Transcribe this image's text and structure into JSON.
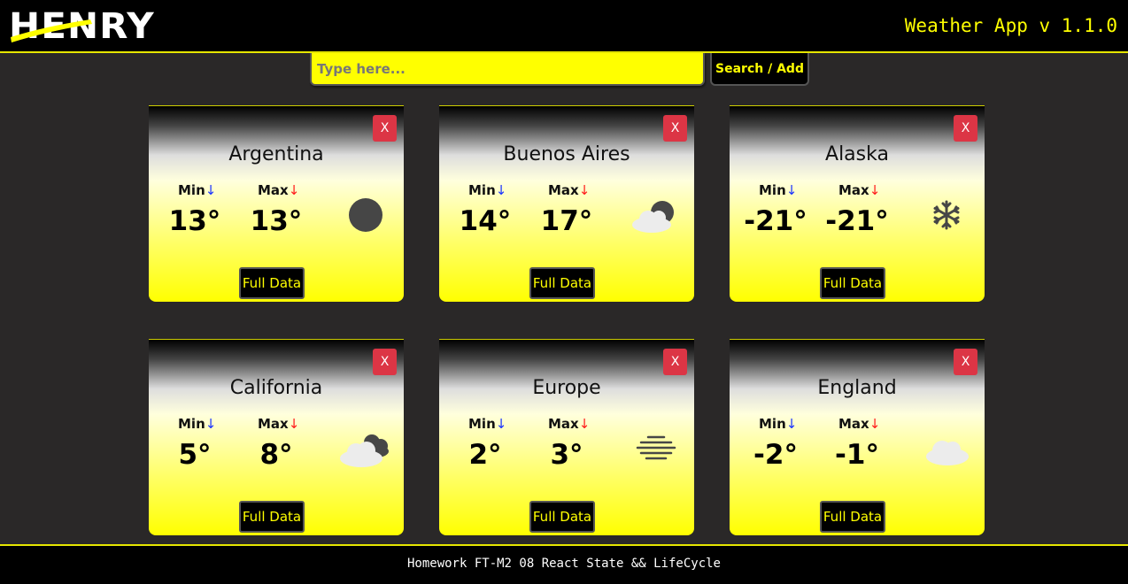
{
  "header": {
    "logo_text": "HENRY",
    "app_title": "Weather App v 1.1.0"
  },
  "search": {
    "placeholder": "Type here...",
    "value": "",
    "button_label": "Search / Add"
  },
  "card_labels": {
    "close": "X",
    "min": "Min",
    "max": "Max",
    "min_arrow": "↓",
    "max_arrow": "↓",
    "full_data": "Full Data"
  },
  "cards": [
    {
      "city": "Argentina",
      "min": "13°",
      "max": "13°",
      "icon": "dark-circle-icon"
    },
    {
      "city": "Buenos Aires",
      "min": "14°",
      "max": "17°",
      "icon": "cloud-moon-icon"
    },
    {
      "city": "Alaska",
      "min": "-21°",
      "max": "-21°",
      "icon": "snowflake-icon"
    },
    {
      "city": "California",
      "min": "5°",
      "max": "8°",
      "icon": "broken-clouds-icon"
    },
    {
      "city": "Europe",
      "min": "2°",
      "max": "3°",
      "icon": "mist-icon"
    },
    {
      "city": "England",
      "min": "-2°",
      "max": "-1°",
      "icon": "cloud-icon"
    }
  ],
  "footer": {
    "text": "Homework FT-M2 08 React State && LifeCycle"
  },
  "colors": {
    "accent": "#ffff00",
    "background": "#2a2828",
    "close_button": "#dc3545",
    "min_arrow": "#1a33ff",
    "max_arrow": "#ff1a1a"
  }
}
